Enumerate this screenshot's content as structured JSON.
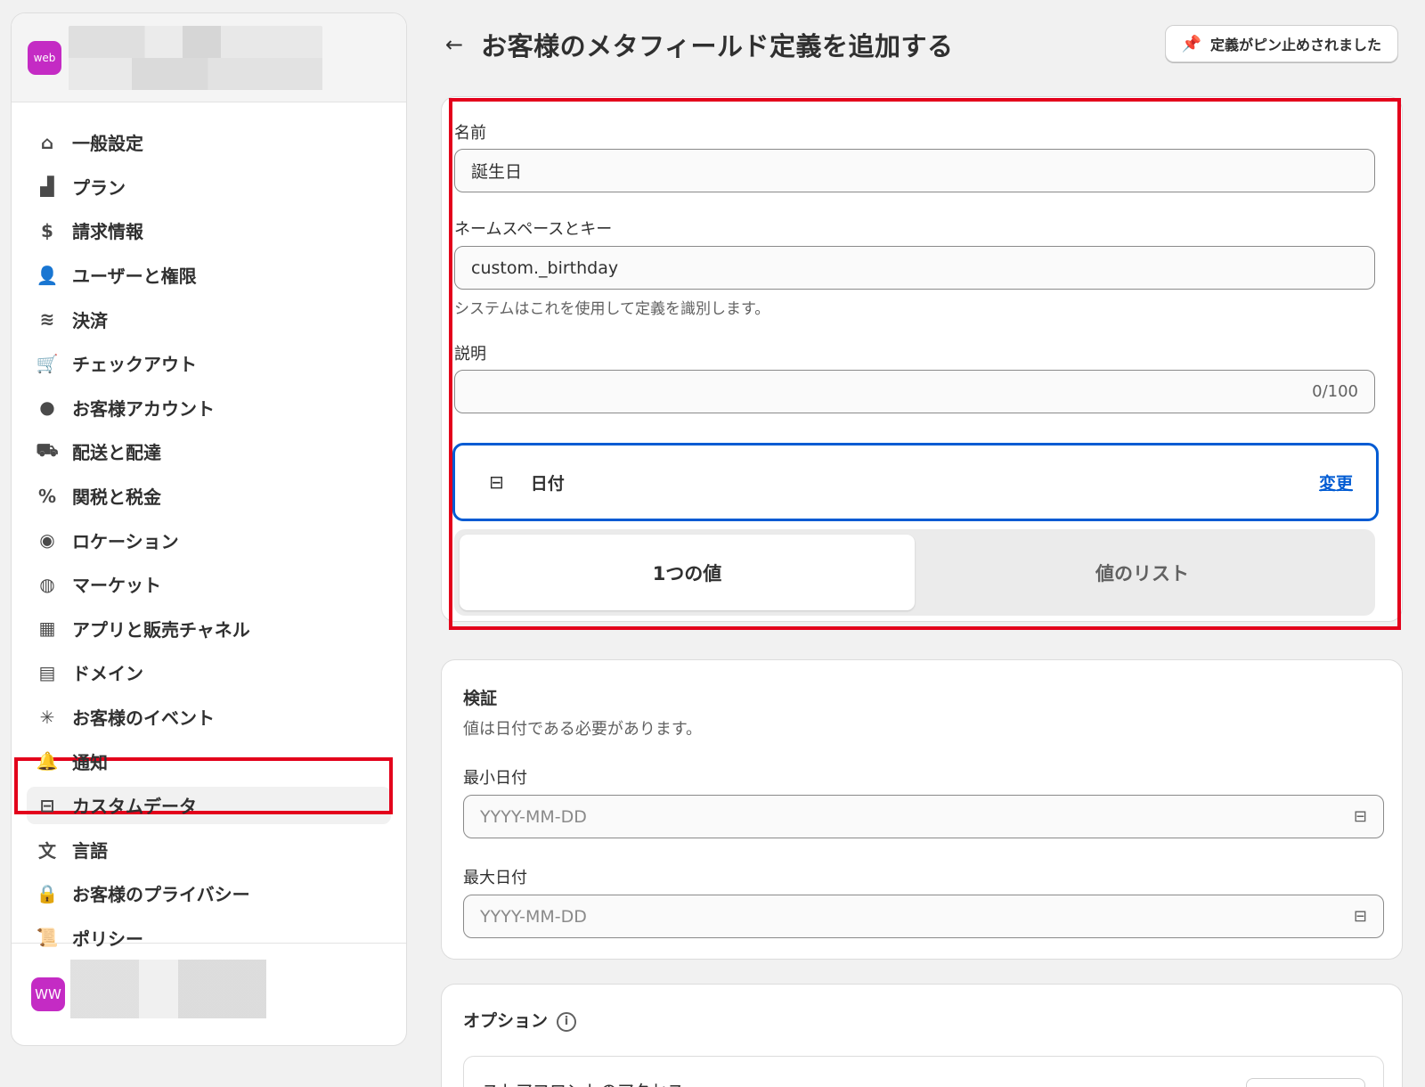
{
  "sidebar": {
    "store_avatar": "web",
    "items": [
      {
        "label": "一般設定",
        "icon": "store-icon",
        "glyph": "⌂"
      },
      {
        "label": "プラン",
        "icon": "plan-icon",
        "glyph": "▟"
      },
      {
        "label": "請求情報",
        "icon": "billing-icon",
        "glyph": "$"
      },
      {
        "label": "ユーザーと権限",
        "icon": "users-icon",
        "glyph": "👤"
      },
      {
        "label": "決済",
        "icon": "payments-icon",
        "glyph": "≋"
      },
      {
        "label": "チェックアウト",
        "icon": "cart-icon",
        "glyph": "🛒"
      },
      {
        "label": "お客様アカウント",
        "icon": "person-icon",
        "glyph": "●"
      },
      {
        "label": "配送と配達",
        "icon": "truck-icon",
        "glyph": "⛟"
      },
      {
        "label": "関税と税金",
        "icon": "tax-icon",
        "glyph": "%"
      },
      {
        "label": "ロケーション",
        "icon": "location-icon",
        "glyph": "◉"
      },
      {
        "label": "マーケット",
        "icon": "globe-icon",
        "glyph": "◍"
      },
      {
        "label": "アプリと販売チャネル",
        "icon": "apps-icon",
        "glyph": "▦"
      },
      {
        "label": "ドメイン",
        "icon": "domain-icon",
        "glyph": "▤"
      },
      {
        "label": "お客様のイベント",
        "icon": "cursor-icon",
        "glyph": "✳"
      },
      {
        "label": "通知",
        "icon": "bell-icon",
        "glyph": "🔔"
      },
      {
        "label": "カスタムデータ",
        "icon": "custom-data-icon",
        "glyph": "⊟"
      },
      {
        "label": "言語",
        "icon": "language-icon",
        "glyph": "文"
      },
      {
        "label": "お客様のプライバシー",
        "icon": "lock-icon",
        "glyph": "🔒"
      },
      {
        "label": "ポリシー",
        "icon": "policy-icon",
        "glyph": "📜"
      }
    ],
    "active_index": 15,
    "footer_avatar": "WW"
  },
  "header": {
    "back_icon": "arrow-left-icon",
    "title": "お客様のメタフィールド定義を追加する",
    "pin_button": "定義がピン止めされました"
  },
  "definition": {
    "name_label": "名前",
    "name_value": "誕生日",
    "namespace_label": "ネームスペースとキー",
    "namespace_value": "custom._birthday",
    "namespace_help": "システムはこれを使用して定義を識別します。",
    "description_label": "説明",
    "description_value": "",
    "description_counter": "0/100",
    "type_label": "日付",
    "type_change": "変更",
    "segment_single": "1つの値",
    "segment_list": "値のリスト"
  },
  "validation": {
    "title": "検証",
    "subtitle": "値は日付である必要があります。",
    "min_label": "最小日付",
    "min_placeholder": "YYYY-MM-DD",
    "max_label": "最大日付",
    "max_placeholder": "YYYY-MM-DD"
  },
  "options": {
    "title": "オプション",
    "storefront_access": "ストアフロントのアクセス"
  },
  "colors": {
    "highlight_red": "#e3001b",
    "accent_blue": "#005bd3",
    "avatar_magenta": "#c42bc4"
  }
}
